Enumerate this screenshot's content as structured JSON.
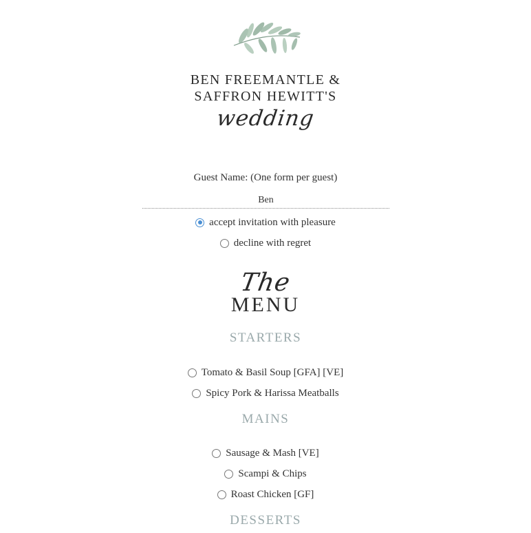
{
  "header": {
    "names_line1": "BEN FREEMANTLE &",
    "names_line2": "SAFFRON HEWITT'S",
    "script_word": "wedding"
  },
  "guest": {
    "label": "Guest Name: (One form per guest)",
    "value": "Ben"
  },
  "rsvp": {
    "options": [
      {
        "label": "accept invitation with pleasure",
        "selected": true
      },
      {
        "label": "decline with regret",
        "selected": false
      }
    ]
  },
  "menu": {
    "script_title": "The",
    "title": "MENU",
    "sections": [
      {
        "heading": "STARTERS",
        "items": [
          {
            "label": "Tomato & Basil Soup [GFA] [VE]",
            "selected": false
          },
          {
            "label": "Spicy Pork & Harissa Meatballs",
            "selected": false
          }
        ]
      },
      {
        "heading": "MAINS",
        "items": [
          {
            "label": "Sausage & Mash [VE]",
            "selected": false
          },
          {
            "label": "Scampi & Chips",
            "selected": false
          },
          {
            "label": "Roast Chicken [GF]",
            "selected": false
          }
        ]
      },
      {
        "heading": "DESSERTS",
        "items": []
      }
    ]
  },
  "colors": {
    "accent_radio": "#4a8fd3",
    "section_heading": "#9aa9ab",
    "leaf_green": "#8fae9a"
  }
}
